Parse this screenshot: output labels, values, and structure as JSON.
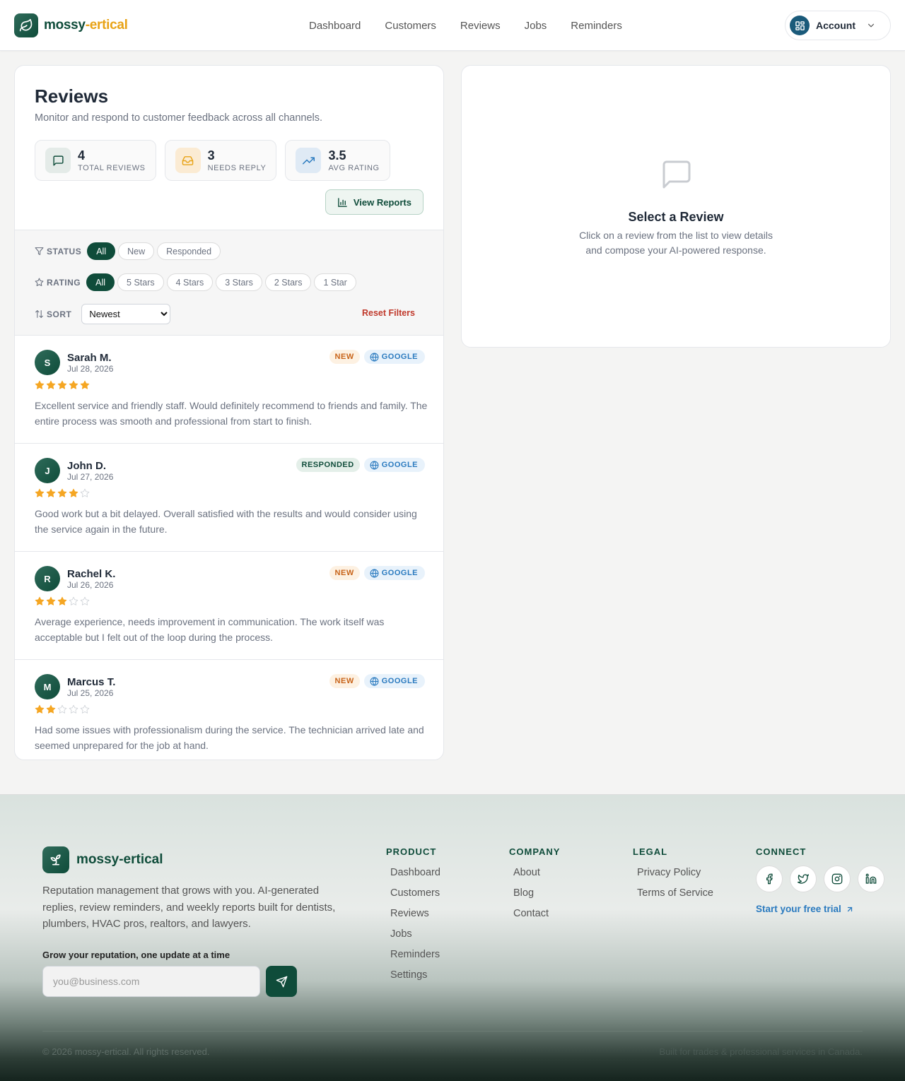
{
  "brand": {
    "name_part1": "mossy",
    "name_part2": "-ertical",
    "accent": "#0f4c3a",
    "highlight": "#e8a317"
  },
  "nav": [
    {
      "label": "Dashboard"
    },
    {
      "label": "Customers"
    },
    {
      "label": "Reviews"
    },
    {
      "label": "Jobs"
    },
    {
      "label": "Reminders"
    }
  ],
  "account": {
    "label": "Account"
  },
  "reviews_page": {
    "title": "Reviews",
    "subtitle": "Monitor and respond to customer feedback across all channels.",
    "stats": [
      {
        "value": "4",
        "label": "TOTAL REVIEWS",
        "icon": "message-square-icon"
      },
      {
        "value": "3",
        "label": "NEEDS REPLY",
        "icon": "inbox-icon"
      },
      {
        "value": "3.5",
        "label": "AVG RATING",
        "icon": "trending-up-icon"
      }
    ],
    "view_reports_label": "View Reports"
  },
  "filters": {
    "status_label": "STATUS",
    "status_options": [
      "All",
      "New",
      "Responded"
    ],
    "status_selected": "All",
    "rating_label": "RATING",
    "rating_options": [
      "All",
      "5 Stars",
      "4 Stars",
      "3 Stars",
      "2 Stars",
      "1 Star"
    ],
    "rating_selected": "All",
    "sort_label": "SORT",
    "sort_selected": "Newest",
    "reset_label": "Reset Filters"
  },
  "reviews": [
    {
      "initial": "S",
      "name": "Sarah M.",
      "date": "Jul 28, 2026",
      "rating": 5,
      "status": "NEW",
      "source": "GOOGLE",
      "text": "Excellent service and friendly staff. Would definitely recommend to friends and family. The entire process was smooth and professional from start to finish."
    },
    {
      "initial": "J",
      "name": "John D.",
      "date": "Jul 27, 2026",
      "rating": 4,
      "status": "RESPONDED",
      "source": "GOOGLE",
      "text": "Good work but a bit delayed. Overall satisfied with the results and would consider using the service again in the future."
    },
    {
      "initial": "R",
      "name": "Rachel K.",
      "date": "Jul 26, 2026",
      "rating": 3,
      "status": "NEW",
      "source": "GOOGLE",
      "text": "Average experience, needs improvement in communication. The work itself was acceptable but I felt out of the loop during the process."
    },
    {
      "initial": "M",
      "name": "Marcus T.",
      "date": "Jul 25, 2026",
      "rating": 2,
      "status": "NEW",
      "source": "GOOGLE",
      "text": "Had some issues with professionalism during the service. The technician arrived late and seemed unprepared for the job at hand."
    }
  ],
  "detail_panel": {
    "title": "Select a Review",
    "description": "Click on a review from the list to view details and compose your AI-powered response."
  },
  "footer": {
    "brand_name": "mossy-ertical",
    "description": "Reputation management that grows with you. AI-generated replies, review reminders, and weekly reports built for dentists, plumbers, HVAC pros, realtors, and lawyers.",
    "newsletter_label": "Grow your reputation, one update at a time",
    "email_placeholder": "you@business.com",
    "columns": [
      {
        "heading": "PRODUCT",
        "links": [
          "Dashboard",
          "Customers",
          "Reviews",
          "Jobs",
          "Reminders",
          "Settings"
        ]
      },
      {
        "heading": "COMPANY",
        "links": [
          "About",
          "Blog",
          "Contact"
        ]
      },
      {
        "heading": "LEGAL",
        "links": [
          "Privacy Policy",
          "Terms of Service"
        ]
      }
    ],
    "connect_heading": "CONNECT",
    "socials": [
      "facebook-icon",
      "twitter-icon",
      "instagram-icon",
      "linkedin-icon"
    ],
    "trial_label": "Start your free trial",
    "copyright": "© 2026 mossy-ertical. All rights reserved.",
    "built_for": "Built for trades & professional services in Canada."
  }
}
